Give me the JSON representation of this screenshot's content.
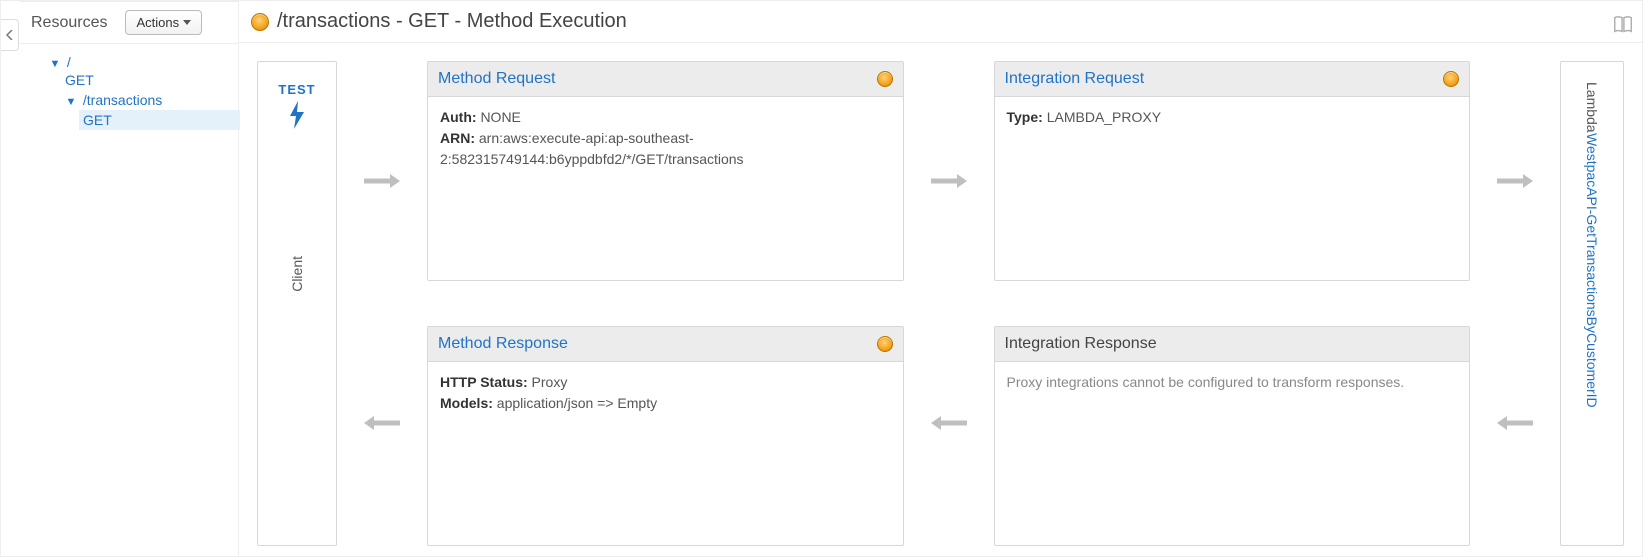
{
  "sidebar": {
    "title": "Resources",
    "actions_label": "Actions",
    "tree": {
      "root": "/",
      "root_get": "GET",
      "transactions": "/transactions",
      "transactions_get": "GET"
    }
  },
  "header": {
    "title": "/transactions - GET - Method Execution"
  },
  "client": {
    "test_label": "TEST",
    "label": "Client"
  },
  "lambda": {
    "prefix": "Lambda",
    "function_name": "WestpacAPI-GetTransactionsByCustomerID"
  },
  "method_request": {
    "title": "Method Request",
    "auth_label": "Auth:",
    "auth_value": "NONE",
    "arn_label": "ARN:",
    "arn_value": "arn:aws:execute-api:ap-southeast-2:582315749144:b6yppdbfd2/*/GET/transactions"
  },
  "integration_request": {
    "title": "Integration Request",
    "type_label": "Type:",
    "type_value": "LAMBDA_PROXY"
  },
  "method_response": {
    "title": "Method Response",
    "http_status_label": "HTTP Status:",
    "http_status_value": "Proxy",
    "models_label": "Models:",
    "models_value": "application/json => Empty"
  },
  "integration_response": {
    "title": "Integration Response",
    "message": "Proxy integrations cannot be configured to transform responses."
  }
}
